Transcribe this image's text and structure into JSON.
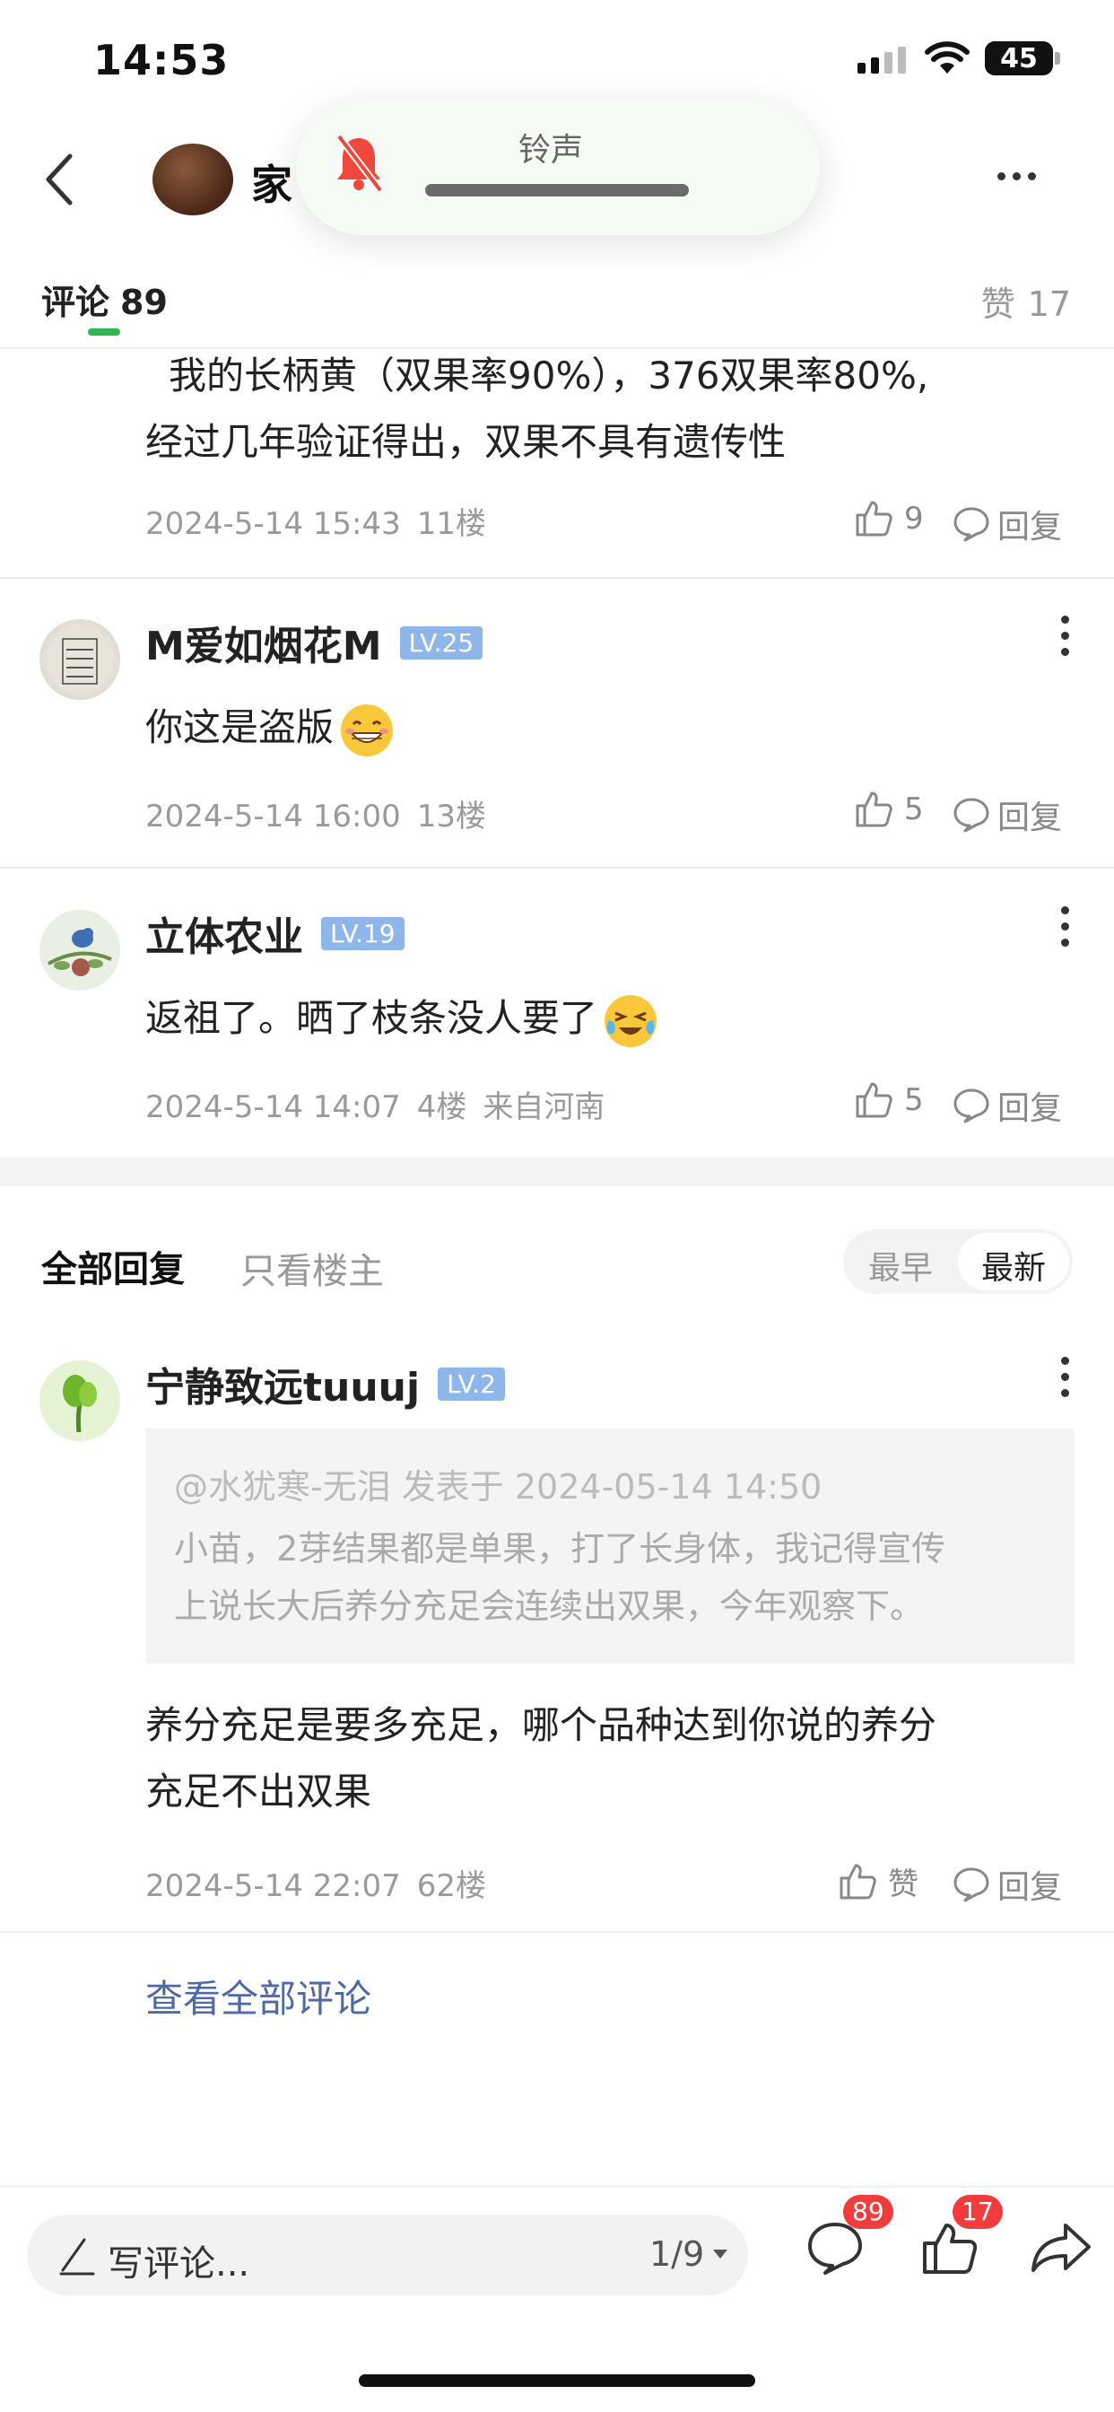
{
  "status": {
    "time": "14:53",
    "battery": "45"
  },
  "nav": {
    "title": "家"
  },
  "ringer": {
    "label": "铃声"
  },
  "tabs": {
    "comments_label": "评论",
    "comments_count": "89",
    "likes_label": "赞",
    "likes_count": "17"
  },
  "comments": [
    {
      "text_lines": [
        "我的长柄黄（双果率90%），376双果率80%,",
        "经过几年验证得出，双果不具有遗传性"
      ],
      "date": "2024-5-14 15:43",
      "floor": "11楼",
      "likes": "9",
      "reply_label": "回复"
    },
    {
      "user": "M爱如烟花M",
      "level": "LV.25",
      "text": "你这是盗版",
      "emoji": "grin-emoji",
      "date": "2024-5-14 16:00",
      "floor": "13楼",
      "likes": "5",
      "reply_label": "回复"
    },
    {
      "user": "立体农业",
      "level": "LV.19",
      "text": "返祖了。晒了枝条没人要了",
      "emoji": "crying-laughing-emoji",
      "date": "2024-5-14 14:07",
      "floor": "4楼",
      "location": "来自河南",
      "likes": "5",
      "reply_label": "回复"
    }
  ],
  "filters": {
    "all": "全部回复",
    "owner_only": "只看楼主",
    "sort_early": "最早",
    "sort_new": "最新"
  },
  "reply": {
    "user": "宁静致远tuuuj",
    "level": "LV.2",
    "quote_head": "@水犹寒-无泪 发表于 2024-05-14 14:50",
    "quote_lines": [
      "小苗，2芽结果都是单果，打了长身体，我记得宣传",
      "上说长大后养分充足会连续出双果，今年观察下。"
    ],
    "text_lines": [
      "养分充足是要多充足，哪个品种达到你说的养分",
      "充足不出双果"
    ],
    "date": "2024-5-14 22:07",
    "floor": "62楼",
    "like_label": "赞",
    "reply_label": "回复"
  },
  "view_all": "查看全部评论",
  "bottom": {
    "compose": "写评论...",
    "page": "1/9",
    "comment_badge": "89",
    "like_badge": "17"
  },
  "colors": {
    "accent": "#2fb84f",
    "link": "#4d6aa6",
    "badge": "#f23b3b",
    "level": "#8fb6ea"
  }
}
